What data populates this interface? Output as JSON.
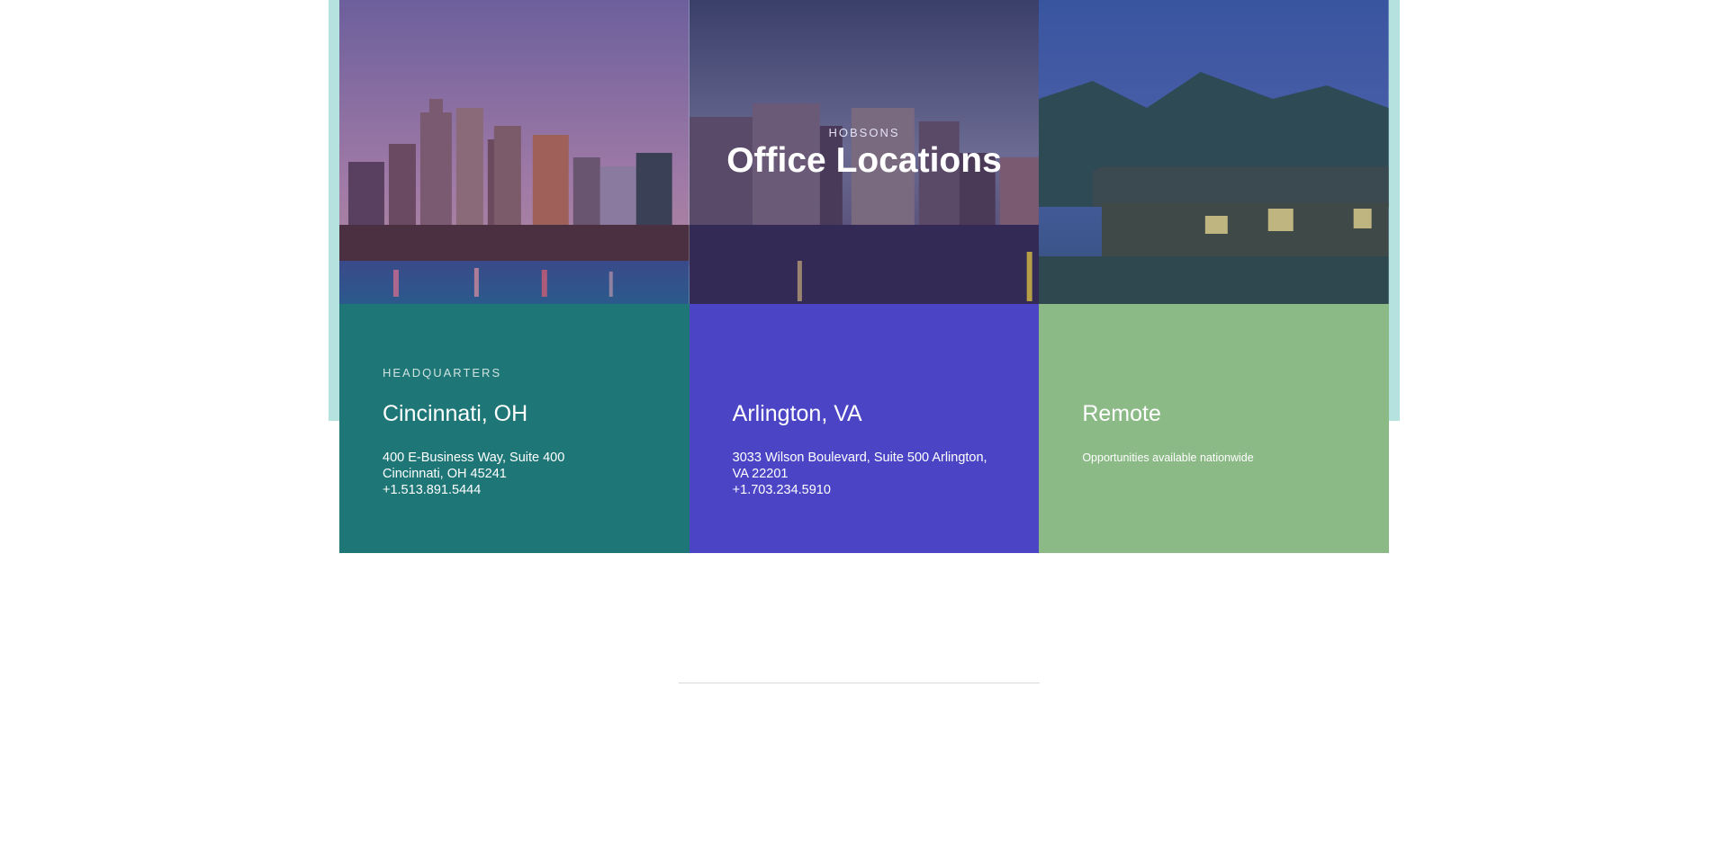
{
  "hero": {
    "eyebrow": "HOBSONS",
    "title": "Office Locations"
  },
  "offices": [
    {
      "kicker": "HEADQUARTERS",
      "city": "Cincinnati, OH",
      "address_lines": [
        "400 E-Business Way, Suite 400",
        "Cincinnati, OH 45241",
        "+1.513.891.5444"
      ],
      "color": "#1f7677",
      "photo": "cincinnati-skyline-image"
    },
    {
      "kicker": "",
      "city": "Arlington, VA",
      "address_lines": [
        "3033 Wilson Boulevard, Suite 500 Arlington, VA 22201",
        "+1.703.234.5910"
      ],
      "color": "#4b45c6",
      "photo": "arlington-skyline-image"
    },
    {
      "kicker": "",
      "city": "Remote",
      "address_lines": [
        "Opportunities available nationwide"
      ],
      "color": "#8bba86",
      "photo": "lake-cabin-image"
    }
  ],
  "colors": {
    "backdrop": "#b5e2df",
    "divider": "#d9d9d9"
  }
}
